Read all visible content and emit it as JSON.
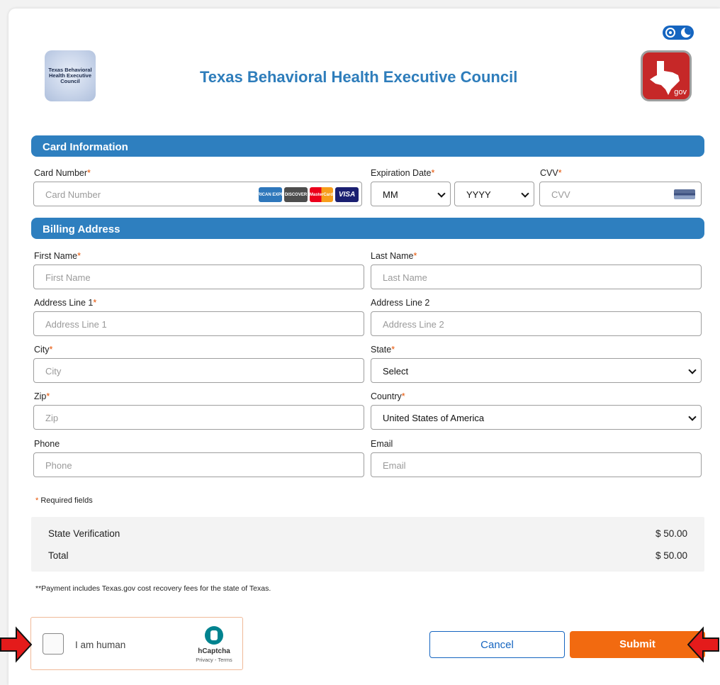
{
  "header": {
    "title": "Texas Behavioral Health Executive Council",
    "agency_logo_text": "Texas Behavioral\nHealth Executive\nCouncil",
    "gov_logo_text": "gov",
    "theme_toggle": {
      "sun_icon": "sun-icon",
      "moon_icon": "moon-icon"
    }
  },
  "card_section": {
    "title": "Card Information",
    "card_number": {
      "label": "Card Number",
      "placeholder": "Card Number"
    },
    "card_brands": [
      "AMERICAN EXPRESS",
      "DISCOVER",
      "MasterCard",
      "VISA"
    ],
    "expiration": {
      "label": "Expiration Date",
      "month": "MM",
      "year": "YYYY"
    },
    "cvv": {
      "label": "CVV",
      "placeholder": "CVV"
    }
  },
  "billing_section": {
    "title": "Billing Address",
    "first_name": {
      "label": "First Name",
      "placeholder": "First Name"
    },
    "last_name": {
      "label": "Last Name",
      "placeholder": "Last Name"
    },
    "address1": {
      "label": "Address Line 1",
      "placeholder": "Address Line 1"
    },
    "address2": {
      "label": "Address Line 2",
      "placeholder": "Address Line 2"
    },
    "city": {
      "label": "City",
      "placeholder": "City"
    },
    "state": {
      "label": "State",
      "value": "Select"
    },
    "zip": {
      "label": "Zip",
      "placeholder": "Zip"
    },
    "country": {
      "label": "Country",
      "value": "United States of America"
    },
    "phone": {
      "label": "Phone",
      "placeholder": "Phone"
    },
    "email": {
      "label": "Email",
      "placeholder": "Email"
    }
  },
  "required_star": "*",
  "required_note": "Required fields",
  "summary": {
    "item_label": "State Verification",
    "item_amount": "$ 50.00",
    "total_label": "Total",
    "total_amount": "$ 50.00"
  },
  "payment_note": "**Payment includes Texas.gov cost recovery fees for the state of Texas.",
  "captcha": {
    "label": "I am human",
    "brand": "hCaptcha",
    "links": "Privacy - Terms"
  },
  "buttons": {
    "cancel": "Cancel",
    "submit": "Submit"
  },
  "colors": {
    "section_bar": "#2e7fbf",
    "title": "#2e7dbb",
    "submit": "#f26a10",
    "cancel_border": "#1565c0",
    "arrow": "#e41b1b",
    "required": "#e65100"
  }
}
